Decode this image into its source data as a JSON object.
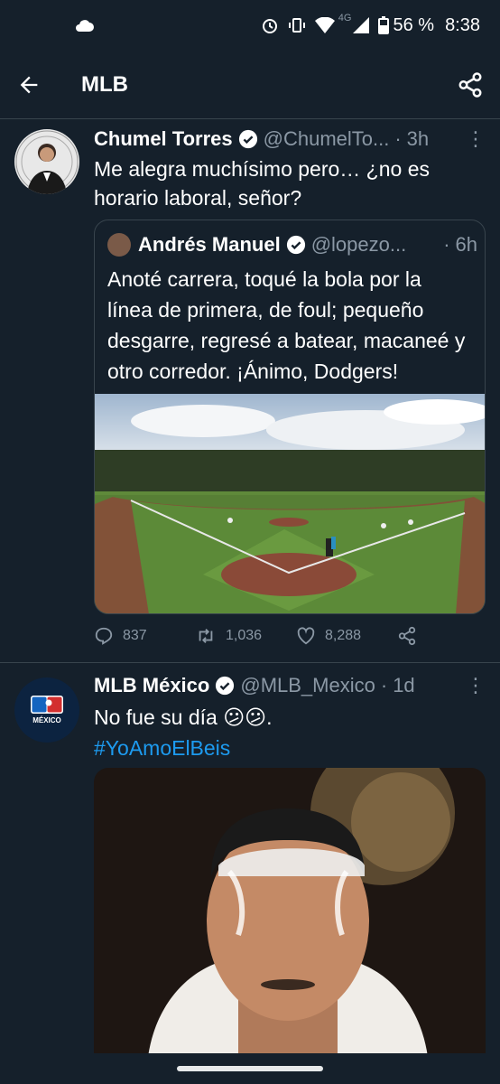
{
  "status_bar": {
    "network": "4G",
    "battery": "56 %",
    "time": "8:38"
  },
  "top_bar": {
    "title": "MLB"
  },
  "tweets": [
    {
      "name": "Chumel Torres",
      "handle": "@ChumelTo...",
      "time": "3h",
      "text": "Me alegra muchísimo pero… ¿no es horario laboral, señor?",
      "quote": {
        "name": "Andrés Manuel",
        "handle": "@lopezo...",
        "time": "6h",
        "text": "Anoté carrera, toqué la bola por la línea de primera, de foul; pequeño desgarre, regresé a batear, macaneé y otro corredor. ¡Ánimo, Dodgers!"
      },
      "replies": "837",
      "retweets": "1,036",
      "likes": "8,288"
    },
    {
      "name": "MLB México",
      "handle": "@MLB_Mexico",
      "time": "1d",
      "text": "No fue su día 😕😕.",
      "hashtag": "#YoAmoElBeis",
      "avatar_label": "MÉXICO"
    }
  ],
  "separator": "·",
  "more_glyph": "⋮",
  "colors": {
    "background": "#15202b",
    "accent": "#1d9bf0",
    "secondary_text": "#8b98a5",
    "border": "#38444d"
  }
}
